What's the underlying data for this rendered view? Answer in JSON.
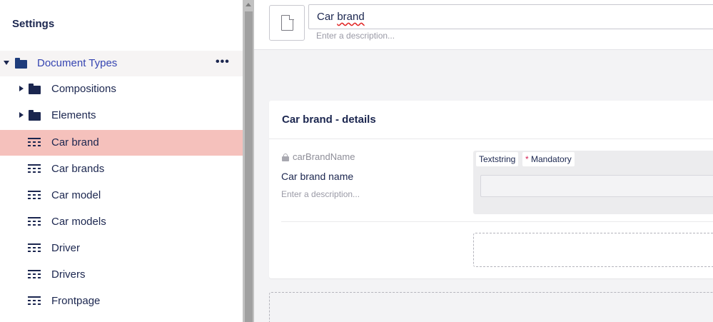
{
  "sidebar": {
    "title": "Settings",
    "root": {
      "label": "Document Types",
      "actions": "•••"
    },
    "items": [
      {
        "label": "Compositions",
        "type": "folder"
      },
      {
        "label": "Elements",
        "type": "folder"
      },
      {
        "label": "Car brand",
        "type": "doctype",
        "selected": true
      },
      {
        "label": "Car brands",
        "type": "doctype"
      },
      {
        "label": "Car model",
        "type": "doctype"
      },
      {
        "label": "Car models",
        "type": "doctype"
      },
      {
        "label": "Driver",
        "type": "doctype"
      },
      {
        "label": "Drivers",
        "type": "doctype"
      },
      {
        "label": "Frontpage",
        "type": "doctype"
      }
    ]
  },
  "header": {
    "name_prefix": "Car ",
    "name_misspelled": "brand",
    "description_placeholder": "Enter a description..."
  },
  "group": {
    "title": "Car brand - details",
    "property": {
      "alias": "carBrandName",
      "name": "Car brand name",
      "description_placeholder": "Enter a description...",
      "editor": "Textstring",
      "mandatory_star": "*",
      "mandatory": "Mandatory"
    }
  },
  "colors": {
    "selected_bg": "#f5c1bc",
    "root_label": "#3544b1",
    "text": "#1b264f"
  }
}
